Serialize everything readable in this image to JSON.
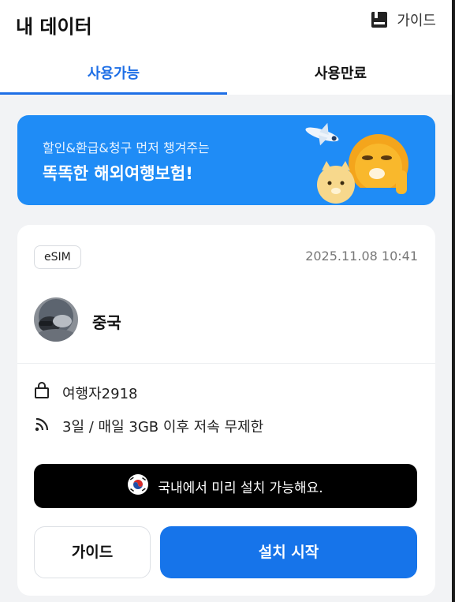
{
  "header": {
    "title": "내 데이터",
    "guide_label": "가이드"
  },
  "tabs": [
    {
      "label": "사용가능",
      "active": true
    },
    {
      "label": "사용만료",
      "active": false
    }
  ],
  "banner": {
    "subtitle": "할인&환급&청구 먼저 챙겨주는",
    "headline": "똑똑한 해외여행보험!"
  },
  "card": {
    "badge": "eSIM",
    "datetime": "2025.11.08 10:41",
    "country": "중국",
    "traveler": "여행자2918",
    "plan": "3일 / 매일 3GB 이후 저속 무제한",
    "notice": "국내에서 미리 설치 가능해요.",
    "guide_button": "가이드",
    "install_button": "설치 시작"
  },
  "colors": {
    "accent": "#1e6fe6",
    "banner": "#1f8cf6",
    "install_button": "#1674ea",
    "notice_bg": "#000000",
    "page_bg": "#f2f3f5"
  },
  "icons": {
    "guide": "bookmark-book-icon",
    "traveler": "bag-icon",
    "plan": "signal-icon",
    "notice": "korea-flag-icon"
  }
}
